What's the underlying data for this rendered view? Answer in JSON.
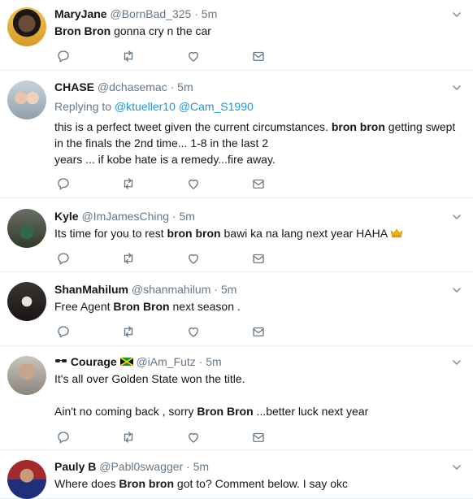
{
  "tweets": [
    {
      "name": "MaryJane",
      "handle": "@BornBad_325",
      "time": "5m",
      "lines": [
        {
          "parts": [
            {
              "t": "Bron Bron",
              "b": true
            },
            {
              "t": " gonna cry n the car"
            }
          ]
        }
      ]
    },
    {
      "name": "CHASE",
      "handle": "@dchasemac",
      "time": "5m",
      "replying_label": "Replying to ",
      "replying_to": [
        "@ktueller10",
        "@Cam_S1990"
      ],
      "lines": [
        {
          "parts": [
            {
              "t": "this is a perfect tweet given the current circumstances. "
            },
            {
              "t": "bron bron",
              "b": true
            },
            {
              "t": " getting swept"
            }
          ]
        },
        {
          "parts": [
            {
              "t": "in the finals the 2nd time... 1-8 in the last 2"
            }
          ]
        },
        {
          "parts": [
            {
              "t": "years ... if kobe hate is a remedy...fire away."
            }
          ]
        }
      ]
    },
    {
      "name": "Kyle",
      "handle": "@ImJamesChing",
      "time": "5m",
      "lines": [
        {
          "parts": [
            {
              "t": "Its time for you to rest "
            },
            {
              "t": "bron bron",
              "b": true
            },
            {
              "t": " bawi ka na lang next year HAHA "
            }
          ],
          "emoji": "crown-emoji"
        }
      ]
    },
    {
      "name": "ShanMahilum",
      "handle": "@shanmahilum",
      "time": "5m",
      "lines": [
        {
          "parts": [
            {
              "t": "Free Agent "
            },
            {
              "t": "Bron Bron",
              "b": true
            },
            {
              "t": " next season ."
            }
          ]
        }
      ]
    },
    {
      "name": "Courage",
      "name_prefix_emoji": "sunglasses-emoji",
      "name_suffix_emoji": "jamaica-flag-emoji",
      "handle": "@iAm_Futz",
      "time": "5m",
      "lines": [
        {
          "parts": [
            {
              "t": "It's all over Golden State won the title."
            }
          ]
        },
        {
          "parts": []
        },
        {
          "parts": [
            {
              "t": "Ain't no coming back , sorry "
            },
            {
              "t": "Bron Bron",
              "b": true
            },
            {
              "t": " ...better luck next year"
            }
          ]
        }
      ]
    },
    {
      "name": "Pauly B",
      "handle": "@Pabl0swagger",
      "time": "5m",
      "lines": [
        {
          "parts": [
            {
              "t": "Where does "
            },
            {
              "t": "Bron bron",
              "b": true
            },
            {
              "t": " got to? Comment below. I say okc"
            }
          ]
        }
      ]
    }
  ],
  "colors": {
    "text": "#14171a",
    "secondary": "#657786",
    "link": "#1b95e0",
    "border": "#e6ecf0",
    "icon": "#657786"
  },
  "action_icons": [
    "reply-icon",
    "retweet-icon",
    "like-icon",
    "direct-message-icon"
  ]
}
